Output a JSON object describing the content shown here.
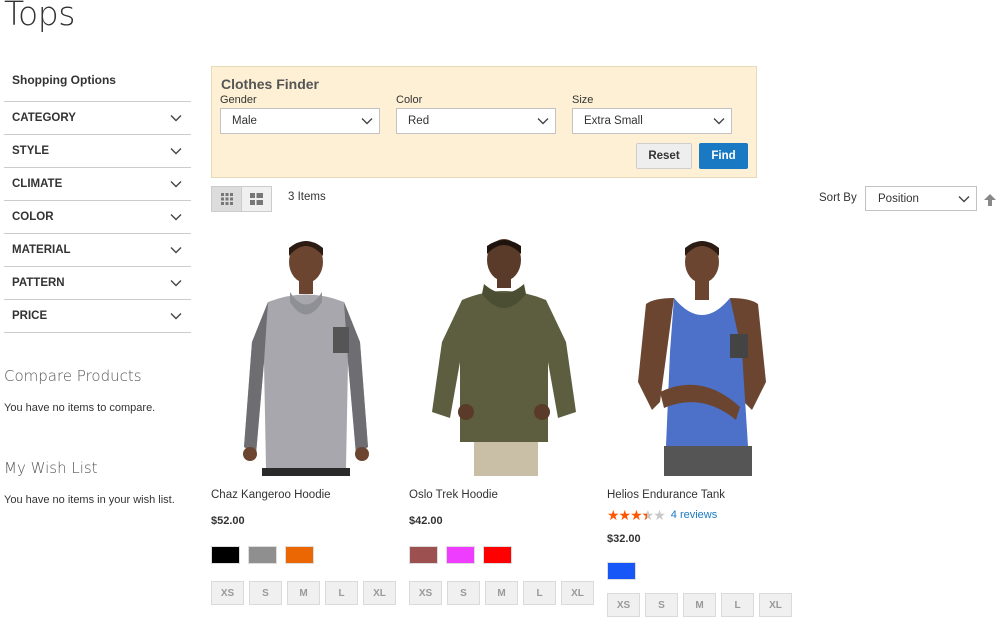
{
  "page": {
    "title": "Tops"
  },
  "sidebar": {
    "shopping_options": "Shopping Options",
    "filters": [
      "CATEGORY",
      "STYLE",
      "CLIMATE",
      "COLOR",
      "MATERIAL",
      "PATTERN",
      "PRICE"
    ],
    "compare": {
      "title": "Compare Products",
      "text": "You have no items to compare."
    },
    "wishlist": {
      "title": "My Wish List",
      "text": "You have no items in your wish list."
    }
  },
  "finder": {
    "title": "Clothes Finder",
    "gender": {
      "label": "Gender",
      "value": "Male"
    },
    "color": {
      "label": "Color",
      "value": "Red"
    },
    "size": {
      "label": "Size",
      "value": "Extra Small"
    },
    "reset_label": "Reset",
    "find_label": "Find"
  },
  "toolbar": {
    "count": "3 Items",
    "sort_label": "Sort By",
    "sort_value": "Position"
  },
  "products": [
    {
      "name": "Chaz Kangeroo Hoodie",
      "price": "$52.00",
      "colors": [
        "#000000",
        "#8f8f8f",
        "#eb6703"
      ],
      "sizes": [
        "XS",
        "S",
        "M",
        "L",
        "XL"
      ]
    },
    {
      "name": "Oslo Trek Hoodie",
      "price": "$42.00",
      "colors": [
        "#9c5050",
        "#ef3dff",
        "#ff0000"
      ],
      "sizes": [
        "XS",
        "S",
        "M",
        "L",
        "XL"
      ]
    },
    {
      "name": "Helios Endurance Tank",
      "price": "$32.00",
      "rating": 3.5,
      "reviews": "4 reviews",
      "colors": [
        "#1857f7"
      ],
      "sizes": [
        "XS",
        "S",
        "M",
        "L",
        "XL"
      ]
    }
  ]
}
